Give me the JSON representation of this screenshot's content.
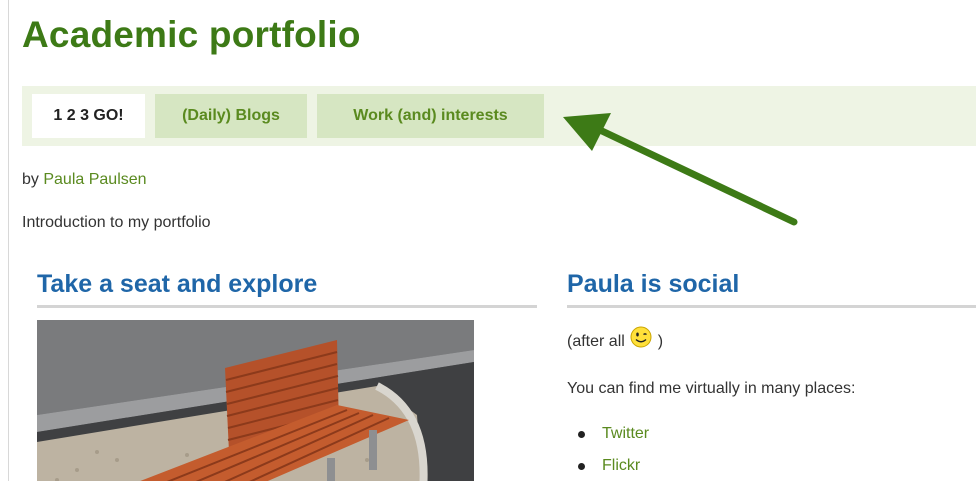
{
  "page": {
    "title": "Academic portfolio"
  },
  "tabs": [
    {
      "label": "1 2 3 GO!",
      "active": true
    },
    {
      "label": "(Daily) Blogs",
      "active": false
    },
    {
      "label": "Work (and) interests",
      "active": false
    }
  ],
  "annotation": {
    "icon": "arrow-icon",
    "color": "#3d7a16"
  },
  "byline": {
    "prefix": "by",
    "author": "Paula Paulsen"
  },
  "intro": "Introduction to my portfolio",
  "left_block": {
    "title": "Take a seat and explore",
    "image_name": "bench-photo"
  },
  "right_block": {
    "title": "Paula is social",
    "sub_prefix": "(after all",
    "sub_suffix": ")",
    "smiley_icon": "smiley-icon",
    "text": "You can find me virtually in many places:",
    "links": [
      {
        "label": "Twitter"
      },
      {
        "label": "Flickr"
      }
    ]
  },
  "colors": {
    "title_green": "#3d7a16",
    "link_green": "#5a8a1f",
    "block_title_blue": "#1f66a8",
    "tabbar_bg": "#eef4e4",
    "tab_inactive_bg": "#d6e6c2"
  }
}
